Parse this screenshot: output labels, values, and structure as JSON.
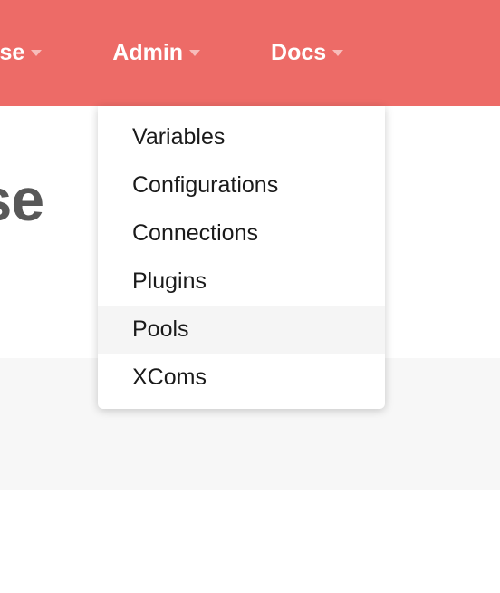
{
  "navbar": {
    "items": [
      {
        "label": "wse"
      },
      {
        "label": "Admin"
      },
      {
        "label": "Docs"
      }
    ]
  },
  "page": {
    "title_fragment": "oose"
  },
  "dropdown": {
    "items": [
      {
        "label": "Variables",
        "highlighted": false
      },
      {
        "label": "Configurations",
        "highlighted": false
      },
      {
        "label": "Connections",
        "highlighted": false
      },
      {
        "label": "Plugins",
        "highlighted": false
      },
      {
        "label": "Pools",
        "highlighted": true
      },
      {
        "label": "XComs",
        "highlighted": false
      }
    ]
  }
}
